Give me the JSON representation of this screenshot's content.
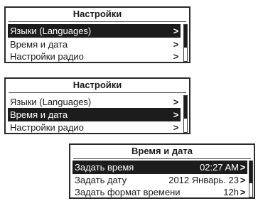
{
  "panel1": {
    "title": "Настройки",
    "items": [
      {
        "label": "Языки (Languages)",
        "chevron": ">"
      },
      {
        "label": "Время и дата",
        "chevron": ">"
      },
      {
        "label": "Настройки радио",
        "chevron": ">"
      }
    ],
    "selected_index": 0,
    "scroll_fraction": 0.6
  },
  "panel2": {
    "title": "Настройки",
    "items": [
      {
        "label": "Языки (Languages)",
        "chevron": ">"
      },
      {
        "label": "Время и дата",
        "chevron": ">"
      },
      {
        "label": "Настройки радио",
        "chevron": ">"
      }
    ],
    "selected_index": 1,
    "scroll_fraction": 0.6
  },
  "panel3": {
    "title": "Время и дата",
    "items": [
      {
        "label": "Задать время",
        "value": "02:27 AM",
        "chevron": ">"
      },
      {
        "label": "Задать дату",
        "value": "2012 Январь. 23",
        "chevron": ">"
      },
      {
        "label": "Задать формат времени",
        "value": "12h",
        "chevron": ">"
      }
    ],
    "selected_index": 0,
    "scroll_fraction": 0.6
  },
  "colors": {
    "highlight": "#1c1c1c",
    "border": "#2a2a2a",
    "background": "#ffffff"
  }
}
